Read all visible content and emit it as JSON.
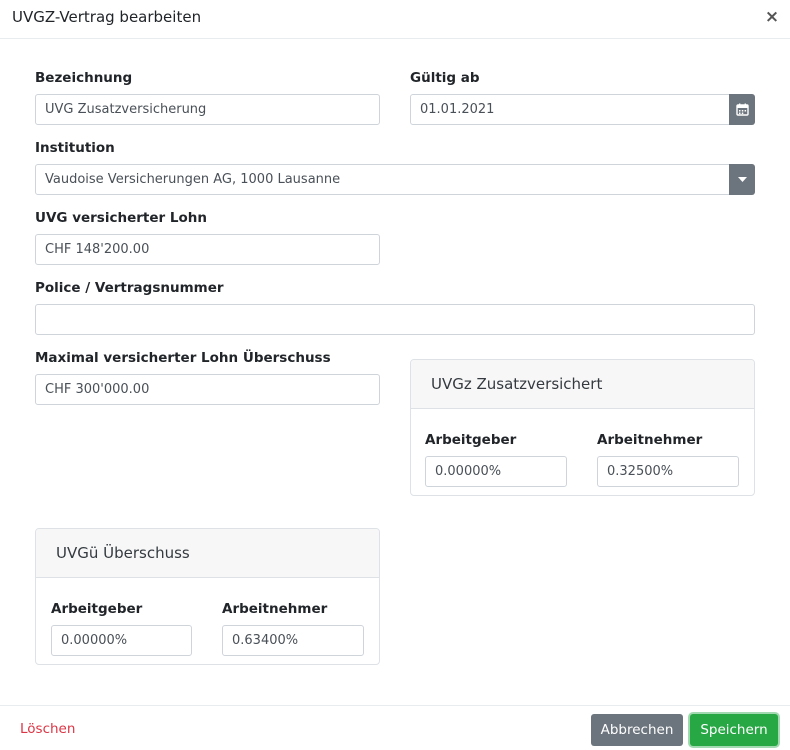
{
  "dialog": {
    "title": "UVGZ-Vertrag bearbeiten"
  },
  "fields": {
    "bezeichnung": {
      "label": "Bezeichnung",
      "value": "UVG Zusatzversicherung"
    },
    "gueltig_ab": {
      "label": "Gültig ab",
      "value": "01.01.2021"
    },
    "institution": {
      "label": "Institution",
      "value": "Vaudoise Versicherungen AG, 1000 Lausanne"
    },
    "uvg_lohn": {
      "label": "UVG versicherter Lohn",
      "value": "CHF 148'200.00"
    },
    "police": {
      "label": "Police / Vertragsnummer",
      "value": ""
    },
    "max_lohn": {
      "label": "Maximal versicherter Lohn Überschuss",
      "value": "CHF 300'000.00"
    }
  },
  "uvgz_card": {
    "title": "UVGz Zusatzversichert",
    "arbeitgeber_label": "Arbeitgeber",
    "arbeitgeber_value": "0.00000%",
    "arbeitnehmer_label": "Arbeitnehmer",
    "arbeitnehmer_value": "0.32500%"
  },
  "uvgue_card": {
    "title": "UVGü Überschuss",
    "arbeitgeber_label": "Arbeitgeber",
    "arbeitgeber_value": "0.00000%",
    "arbeitnehmer_label": "Arbeitnehmer",
    "arbeitnehmer_value": "0.63400%"
  },
  "footer": {
    "delete_label": "Löschen",
    "cancel_label": "Abbrechen",
    "save_label": "Speichern"
  },
  "icons": {
    "close": "close-icon",
    "calendar": "calendar-icon",
    "dropdown": "caret-down-icon"
  },
  "colors": {
    "save": "#28a745",
    "cancel": "#6c757d",
    "delete": "#dc3545",
    "addon": "#6c757d"
  }
}
